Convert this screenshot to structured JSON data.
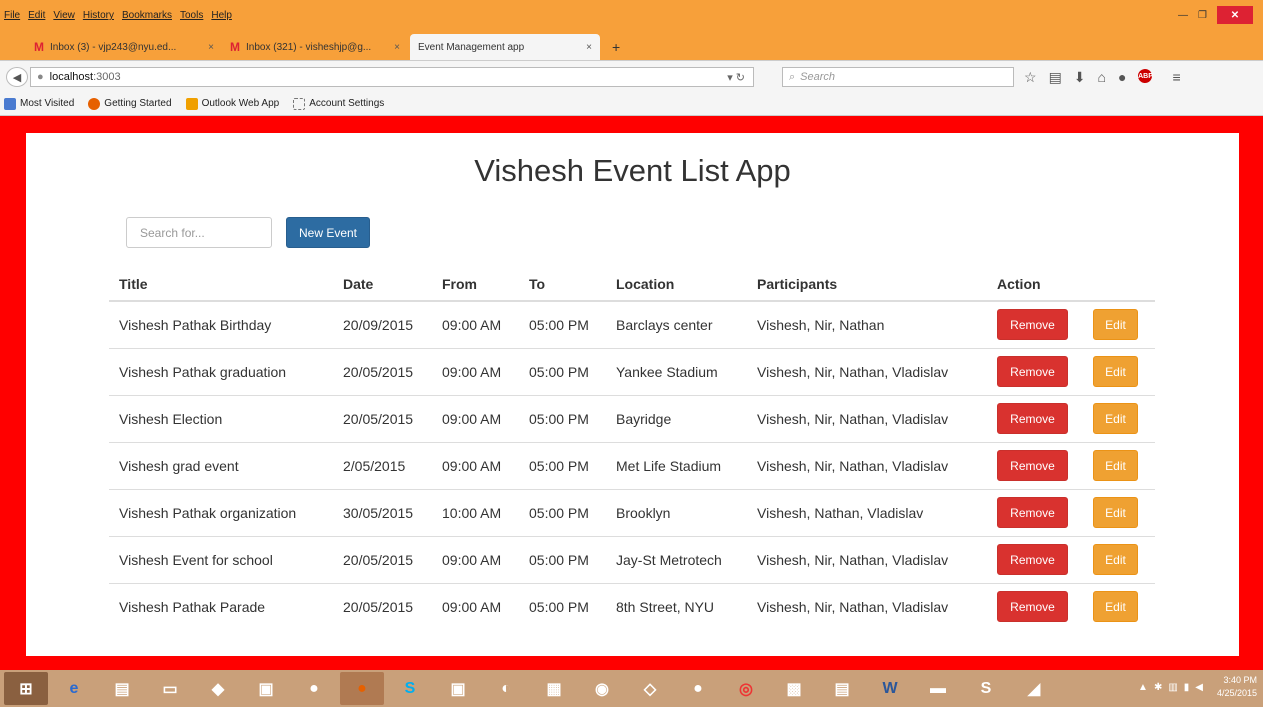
{
  "browser": {
    "menu": [
      "File",
      "Edit",
      "View",
      "History",
      "Bookmarks",
      "Tools",
      "Help"
    ],
    "tabs": [
      {
        "title": "Inbox (3) - vjp243@nyu.ed...",
        "close": "×"
      },
      {
        "title": "Inbox (321) - visheshjp@g...",
        "close": "×"
      },
      {
        "title": "Event Management app",
        "close": "×"
      }
    ],
    "new_tab": "+",
    "url": {
      "host": "localhost",
      "port": ":3003"
    },
    "search_placeholder": "Search",
    "bookmarks": [
      "Most Visited",
      "Getting Started",
      "Outlook Web App",
      "Account Settings"
    ]
  },
  "page": {
    "title": "Vishesh Event List App",
    "search_placeholder": "Search for...",
    "new_event_label": "New Event",
    "columns": [
      "Title",
      "Date",
      "From",
      "To",
      "Location",
      "Participants",
      "Action"
    ],
    "remove_label": "Remove",
    "edit_label": "Edit",
    "events": [
      {
        "title": "Vishesh Pathak Birthday",
        "date": "20/09/2015",
        "from": "09:00 AM",
        "to": "05:00 PM",
        "location": "Barclays center",
        "participants": "Vishesh, Nir, Nathan"
      },
      {
        "title": "Vishesh Pathak graduation",
        "date": "20/05/2015",
        "from": "09:00 AM",
        "to": "05:00 PM",
        "location": "Yankee Stadium",
        "participants": "Vishesh, Nir, Nathan, Vladislav"
      },
      {
        "title": "Vishesh Election",
        "date": "20/05/2015",
        "from": "09:00 AM",
        "to": "05:00 PM",
        "location": "Bayridge",
        "participants": "Vishesh, Nir, Nathan, Vladislav"
      },
      {
        "title": "Vishesh grad event",
        "date": "2/05/2015",
        "from": "09:00 AM",
        "to": "05:00 PM",
        "location": "Met Life Stadium",
        "participants": "Vishesh, Nir, Nathan, Vladislav"
      },
      {
        "title": "Vishesh Pathak organization",
        "date": "30/05/2015",
        "from": "10:00 AM",
        "to": "05:00 PM",
        "location": "Brooklyn",
        "participants": "Vishesh, Nathan, Vladislav"
      },
      {
        "title": "Vishesh Event for school",
        "date": "20/05/2015",
        "from": "09:00 AM",
        "to": "05:00 PM",
        "location": "Jay-St Metrotech",
        "participants": "Vishesh, Nir, Nathan, Vladislav"
      },
      {
        "title": "Vishesh Pathak Parade",
        "date": "20/05/2015",
        "from": "09:00 AM",
        "to": "05:00 PM",
        "location": "8th Street, NYU",
        "participants": "Vishesh, Nir, Nathan, Vladislav"
      }
    ]
  },
  "taskbar": {
    "time": "3:40 PM",
    "date": "4/25/2015"
  },
  "colors": {
    "page_border": "#ff0000",
    "remove": "#d9322f",
    "edit": "#efa132",
    "primary": "#2d6ca2"
  }
}
